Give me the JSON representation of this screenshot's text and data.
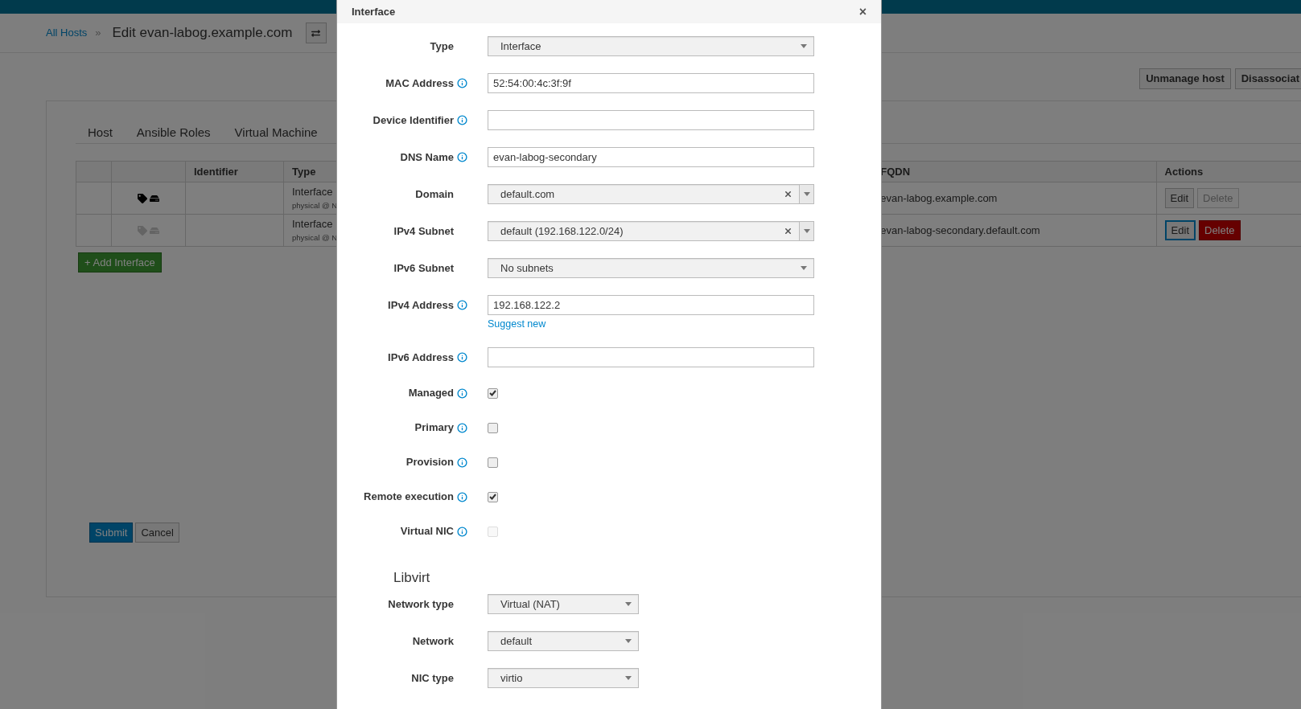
{
  "breadcrumb": {
    "link": "All Hosts",
    "separator": "»",
    "title": "Edit evan-labog.example.com"
  },
  "header_actions": [
    "Unmanage host",
    "Disassociat"
  ],
  "tabs": [
    {
      "label": "Host",
      "selected": false
    },
    {
      "label": "Ansible Roles",
      "selected": false
    },
    {
      "label": "Virtual Machine",
      "selected": false
    }
  ],
  "interfaces_table": {
    "columns": [
      "Identifier",
      "Type",
      "FQDN",
      "Actions"
    ],
    "rows": [
      {
        "flags_active": true,
        "type": "Interface",
        "type_detail": "physical @ N",
        "fqdn": "evan-labog.example.com",
        "edit": "Edit",
        "edit_focused": false,
        "delete": "Delete",
        "delete_enabled": false
      },
      {
        "flags_active": false,
        "type": "Interface",
        "type_detail": "physical @ N",
        "fqdn": "evan-labog-secondary.default.com",
        "edit": "Edit",
        "edit_focused": true,
        "delete": "Delete",
        "delete_enabled": true
      }
    ]
  },
  "add_button": "+ Add Interface",
  "form_buttons": [
    {
      "label": "Submit",
      "kind": "primary"
    },
    {
      "label": "Cancel",
      "kind": "default"
    }
  ],
  "modal": {
    "title": "Interface",
    "close": "×",
    "fields": [
      {
        "kind": "select",
        "label": "Type",
        "value": "Interface",
        "info": false,
        "clearable": false
      },
      {
        "kind": "text",
        "label": "MAC Address",
        "value": "52:54:00:4c:3f:9f",
        "info": true
      },
      {
        "kind": "text",
        "label": "Device Identifier",
        "info": true
      },
      {
        "kind": "text",
        "label": "DNS Name",
        "value": "evan-labog-secondary",
        "info": true
      },
      {
        "kind": "select",
        "label": "Domain",
        "value": "default.com",
        "info": false,
        "clearable": true
      },
      {
        "kind": "select",
        "label": "IPv4 Subnet",
        "value": "default (192.168.122.0/24)",
        "info": false,
        "clearable": true
      },
      {
        "kind": "select",
        "label": "IPv6 Subnet",
        "value": "No subnets",
        "info": false,
        "clearable": false
      },
      {
        "kind": "text",
        "label": "IPv4 Address",
        "value": "192.168.122.2",
        "info": true,
        "link": "Suggest new"
      },
      {
        "kind": "text",
        "label": "IPv6 Address",
        "info": true
      },
      {
        "kind": "checkbox",
        "label": "Managed",
        "info": true,
        "checked": true,
        "disabled": false
      },
      {
        "kind": "checkbox",
        "label": "Primary",
        "info": true,
        "checked": false,
        "disabled": false
      },
      {
        "kind": "checkbox",
        "label": "Provision",
        "info": true,
        "checked": false,
        "disabled": false
      },
      {
        "kind": "checkbox",
        "label": "Remote execution",
        "info": true,
        "checked": true,
        "disabled": false
      },
      {
        "kind": "checkbox",
        "label": "Virtual NIC",
        "info": true,
        "checked": false,
        "disabled": true
      }
    ],
    "section": {
      "title": "Libvirt",
      "fields": [
        {
          "label": "Network type",
          "value": "Virtual (NAT)"
        },
        {
          "label": "Network",
          "value": "default"
        },
        {
          "label": "NIC type",
          "value": "virtio"
        }
      ]
    }
  }
}
